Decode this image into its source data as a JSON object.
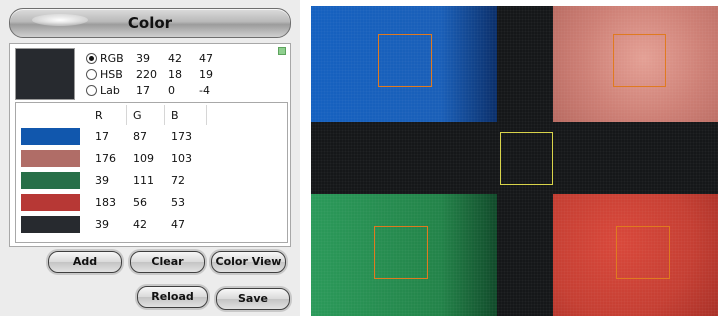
{
  "window": {
    "title": "Color"
  },
  "current_color": {
    "swatch": "#272a2f",
    "modes": [
      {
        "label": "RGB",
        "values": [
          "39",
          "42",
          "47"
        ],
        "checked": true
      },
      {
        "label": "HSB",
        "values": [
          "220",
          "18",
          "19"
        ],
        "checked": false
      },
      {
        "label": "Lab",
        "values": [
          "17",
          "0",
          "-4"
        ],
        "checked": false
      }
    ]
  },
  "table": {
    "headers": [
      "R",
      "G",
      "B"
    ],
    "rows": [
      {
        "swatch": "#1157ad",
        "r": "17",
        "g": "87",
        "b": "173"
      },
      {
        "swatch": "#b06d67",
        "r": "176",
        "g": "109",
        "b": "103"
      },
      {
        "swatch": "#276f48",
        "r": "39",
        "g": "111",
        "b": "72"
      },
      {
        "swatch": "#b73835",
        "r": "183",
        "g": "56",
        "b": "53"
      },
      {
        "swatch": "#272a2f",
        "r": "39",
        "g": "42",
        "b": "47"
      }
    ]
  },
  "buttons": {
    "add": "Add",
    "clear": "Clear",
    "color_view": "Color View",
    "reload": "Reload",
    "save": "Save"
  },
  "colors": {
    "selection_box": "#e07a1f",
    "center_selection_box": "#d8d34a"
  }
}
